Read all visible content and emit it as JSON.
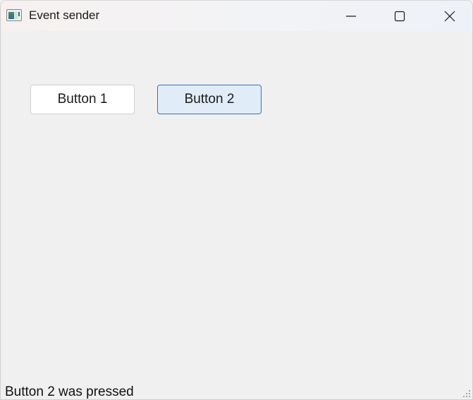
{
  "window": {
    "title": "Event sender",
    "app_icon": "app-window-icon",
    "controls": {
      "minimize_icon": "minimize-icon",
      "maximize_icon": "maximize-icon",
      "close_icon": "close-icon"
    }
  },
  "main": {
    "buttons": [
      {
        "label": "Button 1",
        "state": "normal"
      },
      {
        "label": "Button 2",
        "state": "focused"
      }
    ]
  },
  "statusbar": {
    "message": "Button 2 was pressed",
    "grip_icon": "size-grip-icon"
  },
  "colors": {
    "window_background": "#f0f0f0",
    "focused_button_border": "#2b78c4",
    "focused_button_fill": "#e0ecf8"
  }
}
